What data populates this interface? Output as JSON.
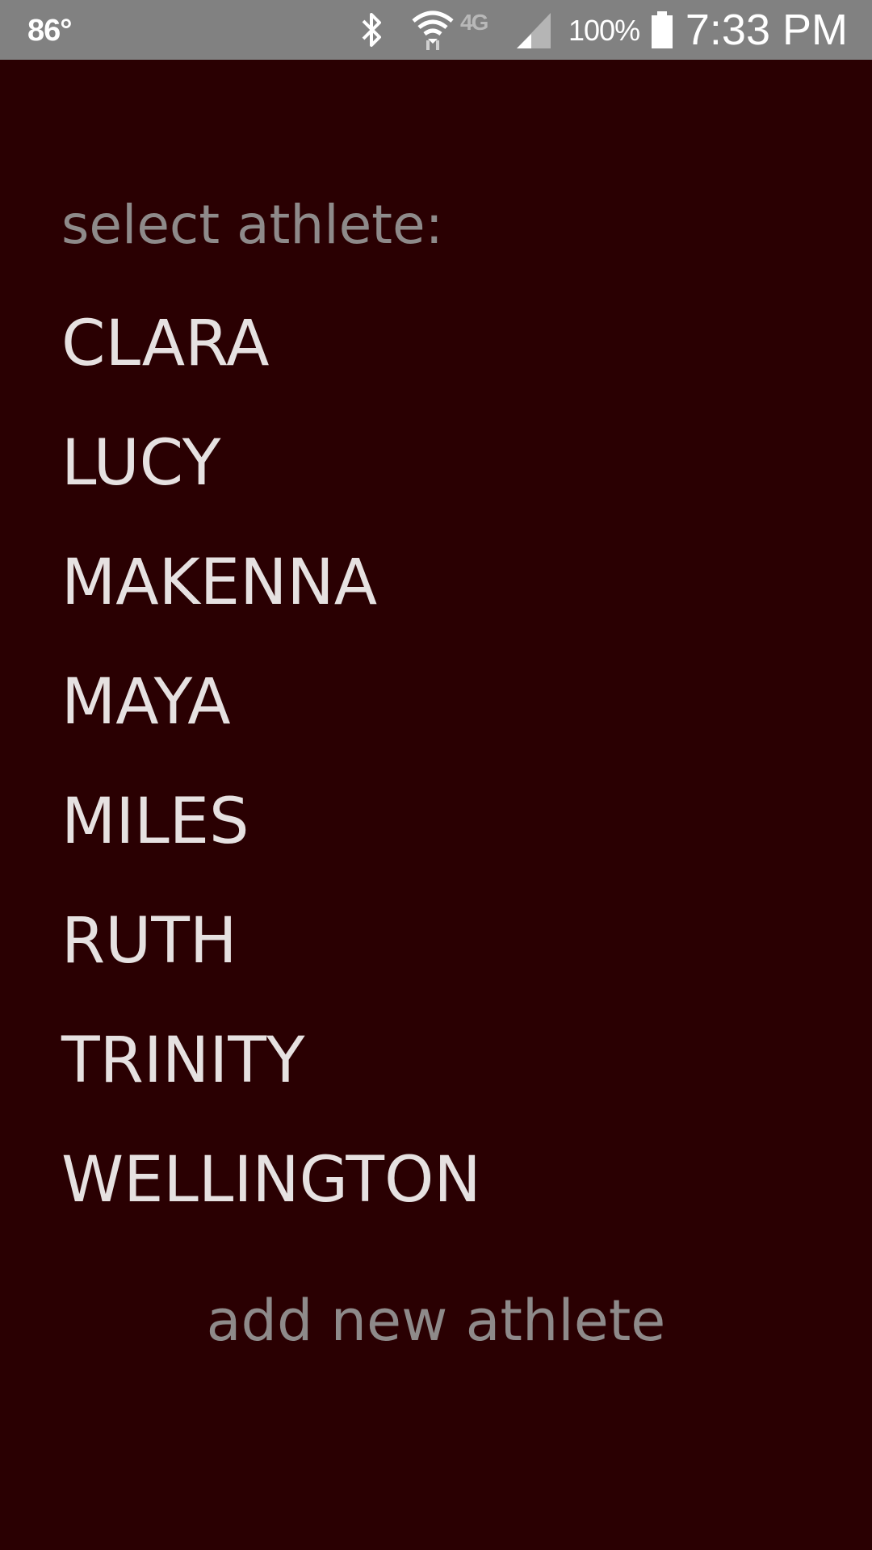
{
  "status_bar": {
    "temperature": "86°",
    "network": "4G",
    "battery_percent": "100%",
    "time": "7:33 PM",
    "icons": [
      "bluetooth-icon",
      "wifi-icon",
      "lte-icon",
      "signal-icon",
      "battery-icon"
    ]
  },
  "screen": {
    "prompt": "select athlete:",
    "athletes": [
      "CLARA",
      "LUCY",
      "MAKENNA",
      "MAYA",
      "MILES",
      "RUTH",
      "TRINITY",
      "WELLINGTON"
    ],
    "add_label": "add new athlete"
  },
  "colors": {
    "background": "#2a0002",
    "status_bar": "#818181",
    "list_text": "#e6e1e1",
    "muted_text": "#8e8a8a"
  }
}
